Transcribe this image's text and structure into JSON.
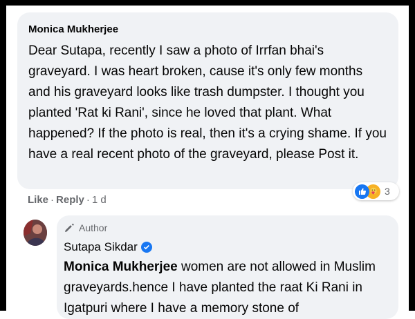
{
  "comment1": {
    "author": "Monica Mukherjee",
    "text": "Dear Sutapa, recently I saw a photo of Irrfan bhai's graveyard. I was heart broken, cause it's only few months and his graveyard looks like trash dumpster. I thought you planted 'Rat ki Rani', since he loved that plant. What happened? If the photo is real, then it's a crying shame. If you have a real recent photo of the graveyard, please Post it.",
    "reactions": {
      "icons": [
        "like-icon",
        "care-icon"
      ],
      "count": "3"
    },
    "actions": {
      "like": "Like",
      "reply": "Reply",
      "separator": "·",
      "time": "1 d"
    }
  },
  "reply1": {
    "role_label": "Author",
    "author": "Sutapa Sikdar",
    "verified": true,
    "mention": "Monica Mukherjee",
    "text": " women are not allowed in Muslim graveyards.hence I have planted the raat Ki Rani in Igatpuri where I have a memory stone of"
  },
  "colors": {
    "bubble": "#f0f2f5",
    "meta": "#65676b",
    "text": "#050505",
    "accent": "#1877f2"
  }
}
